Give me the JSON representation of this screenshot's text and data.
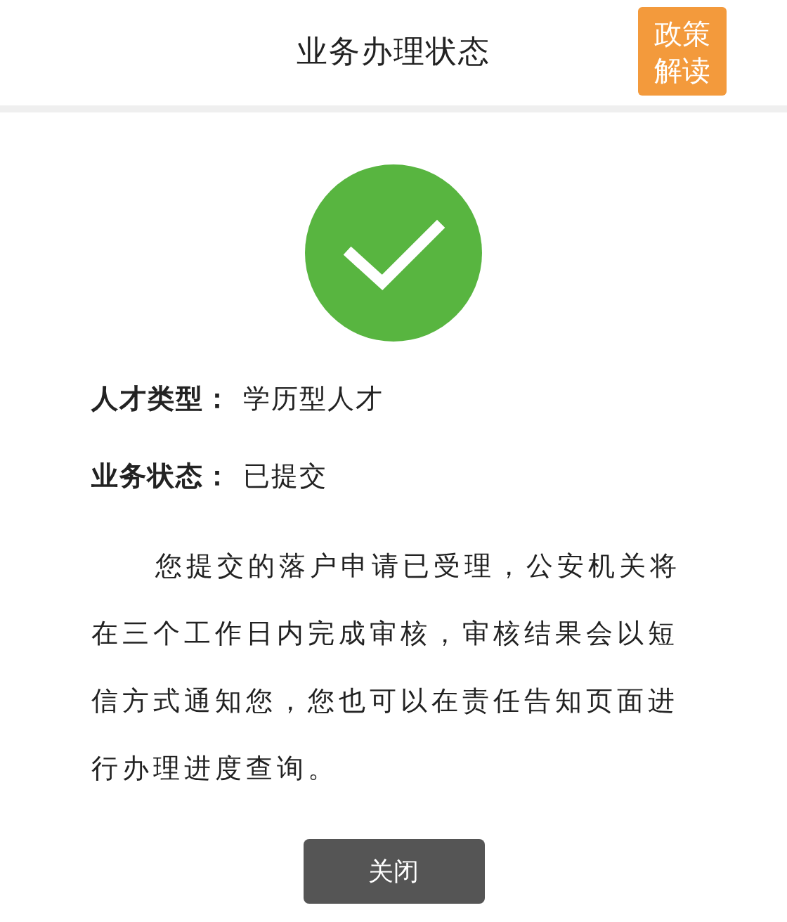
{
  "header": {
    "title": "业务办理状态",
    "policy_button": "政策解读"
  },
  "status_icon": {
    "kind": "success"
  },
  "fields": [
    {
      "label": "人才类型：",
      "value": "学历型人才"
    },
    {
      "label": "业务状态：",
      "value": "已提交"
    }
  ],
  "message": "您提交的落户申请已受理，公安机关将在三个工作日内完成审核，审核结果会以短信方式通知您，您也可以在责任告知页面进行办理进度查询。",
  "buttons": [
    "关闭"
  ]
}
